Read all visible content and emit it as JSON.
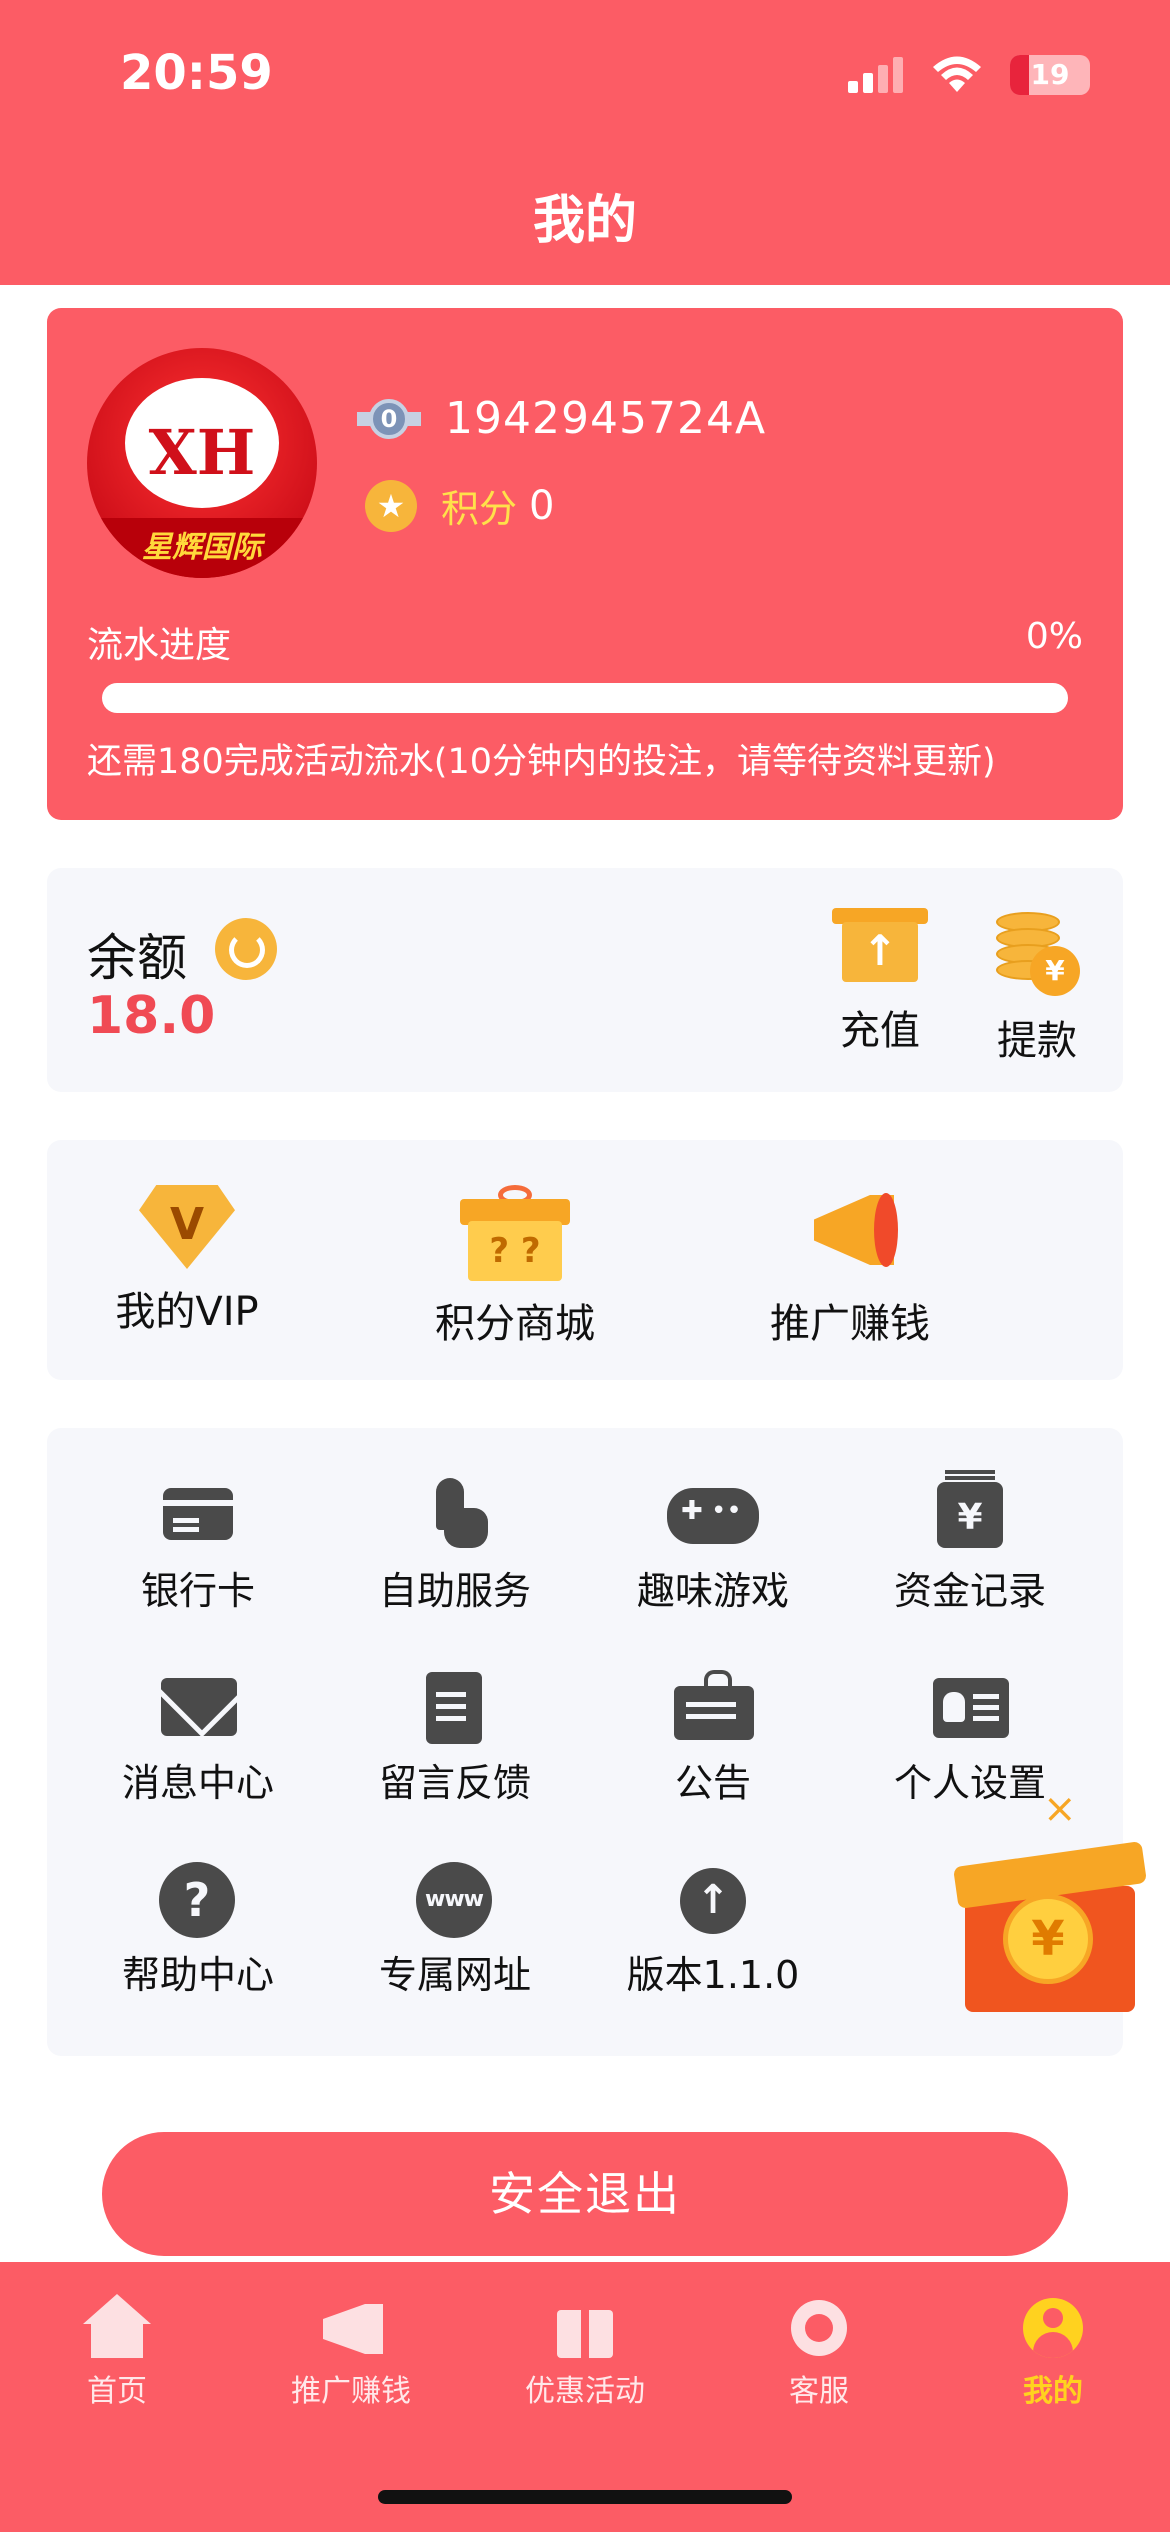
{
  "status_bar": {
    "time": "20:59",
    "battery": "19"
  },
  "header": {
    "title": "我的"
  },
  "profile": {
    "avatar_text": "XH",
    "avatar_band_text": "星辉国际",
    "level_badge": "0",
    "user_id": "1942945724A",
    "points_label": "积分",
    "points_value": "0",
    "progress_label": "流水进度",
    "progress_percent": "0%",
    "progress_value": 0,
    "progress_note": "还需180完成活动流水(10分钟内的投注，请等待资料更新)"
  },
  "balance": {
    "label": "余额",
    "value": "18.0",
    "recharge_label": "充值",
    "withdraw_label": "提款"
  },
  "features": [
    {
      "label": "我的VIP",
      "icon": "vip-diamond-icon"
    },
    {
      "label": "积分商城",
      "icon": "gift-box-icon"
    },
    {
      "label": "推广赚钱",
      "icon": "megaphone-icon"
    }
  ],
  "services": [
    {
      "label": "银行卡",
      "icon": "bank-card-icon"
    },
    {
      "label": "自助服务",
      "icon": "tap-hand-icon"
    },
    {
      "label": "趣味游戏",
      "icon": "gamepad-icon"
    },
    {
      "label": "资金记录",
      "icon": "ledger-icon"
    },
    {
      "label": "消息中心",
      "icon": "mail-icon"
    },
    {
      "label": "留言反馈",
      "icon": "feedback-doc-icon"
    },
    {
      "label": "公告",
      "icon": "notice-board-icon"
    },
    {
      "label": "个人设置",
      "icon": "id-card-icon"
    },
    {
      "label": "帮助中心",
      "icon": "help-icon"
    },
    {
      "label": "专属网址",
      "icon": "www-icon"
    },
    {
      "label": "版本1.1.0",
      "icon": "upload-icon"
    }
  ],
  "promo": {
    "close": "×",
    "coin": "¥"
  },
  "logout_label": "安全退出",
  "tabs": [
    {
      "label": "首页",
      "icon": "home-icon"
    },
    {
      "label": "推广赚钱",
      "icon": "megaphone-icon"
    },
    {
      "label": "优惠活动",
      "icon": "gift-icon"
    },
    {
      "label": "客服",
      "icon": "headset-icon"
    },
    {
      "label": "我的",
      "icon": "user-icon",
      "active": true
    }
  ],
  "colors": {
    "brand": "#fc5c65",
    "accent": "#ffd21f",
    "balance": "#f04a54",
    "icon_dark": "#4a4a4a"
  }
}
